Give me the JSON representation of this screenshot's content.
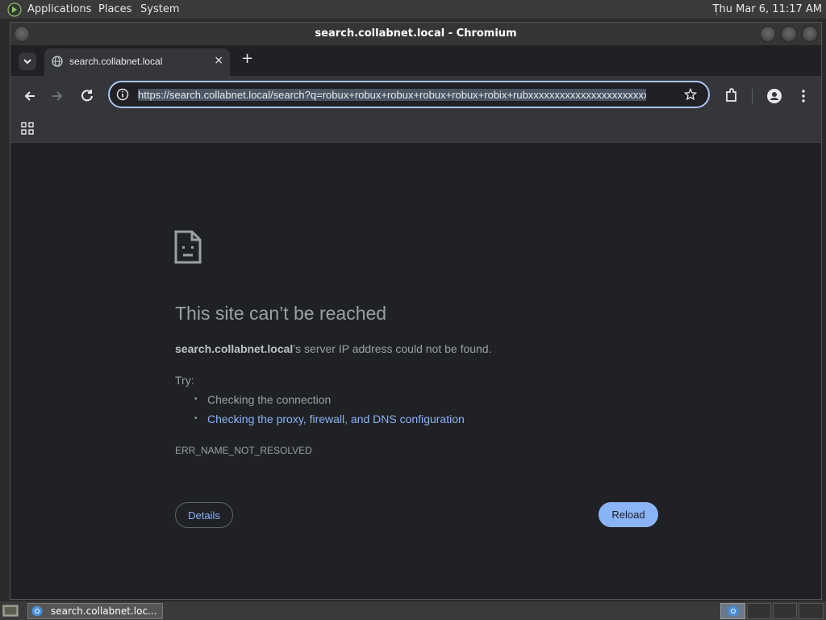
{
  "top_panel": {
    "menus": [
      "Applications",
      "Places",
      "System"
    ],
    "clock": "Thu Mar  6, 11:17 AM"
  },
  "window": {
    "title": "search.collabnet.local - Chromium"
  },
  "tab": {
    "title": "search.collabnet.local",
    "close_icon": "×",
    "new_tab_icon": "+"
  },
  "omnibox": {
    "url": "https://search.collabnet.local/search?q=robux+robux+robux+robux+robux+robix+rubxxxxxxxxxxxxxxxxxxxxxxxxxxxxxxxxxxxx"
  },
  "error_page": {
    "title": "This site can’t be reached",
    "host": "search.collabnet.local",
    "desc_suffix": "’s server IP address could not be found.",
    "try_label": "Try:",
    "suggestions": [
      "Checking the connection",
      "Checking the proxy, firewall, and DNS configuration"
    ],
    "error_code": "ERR_NAME_NOT_RESOLVED",
    "details_label": "Details",
    "reload_label": "Reload"
  },
  "taskbar": {
    "task_label": "search.collabnet.loc..."
  },
  "colors": {
    "accent": "#8ab4f8",
    "page_bg": "#202124",
    "toolbar_bg": "#35363a"
  }
}
